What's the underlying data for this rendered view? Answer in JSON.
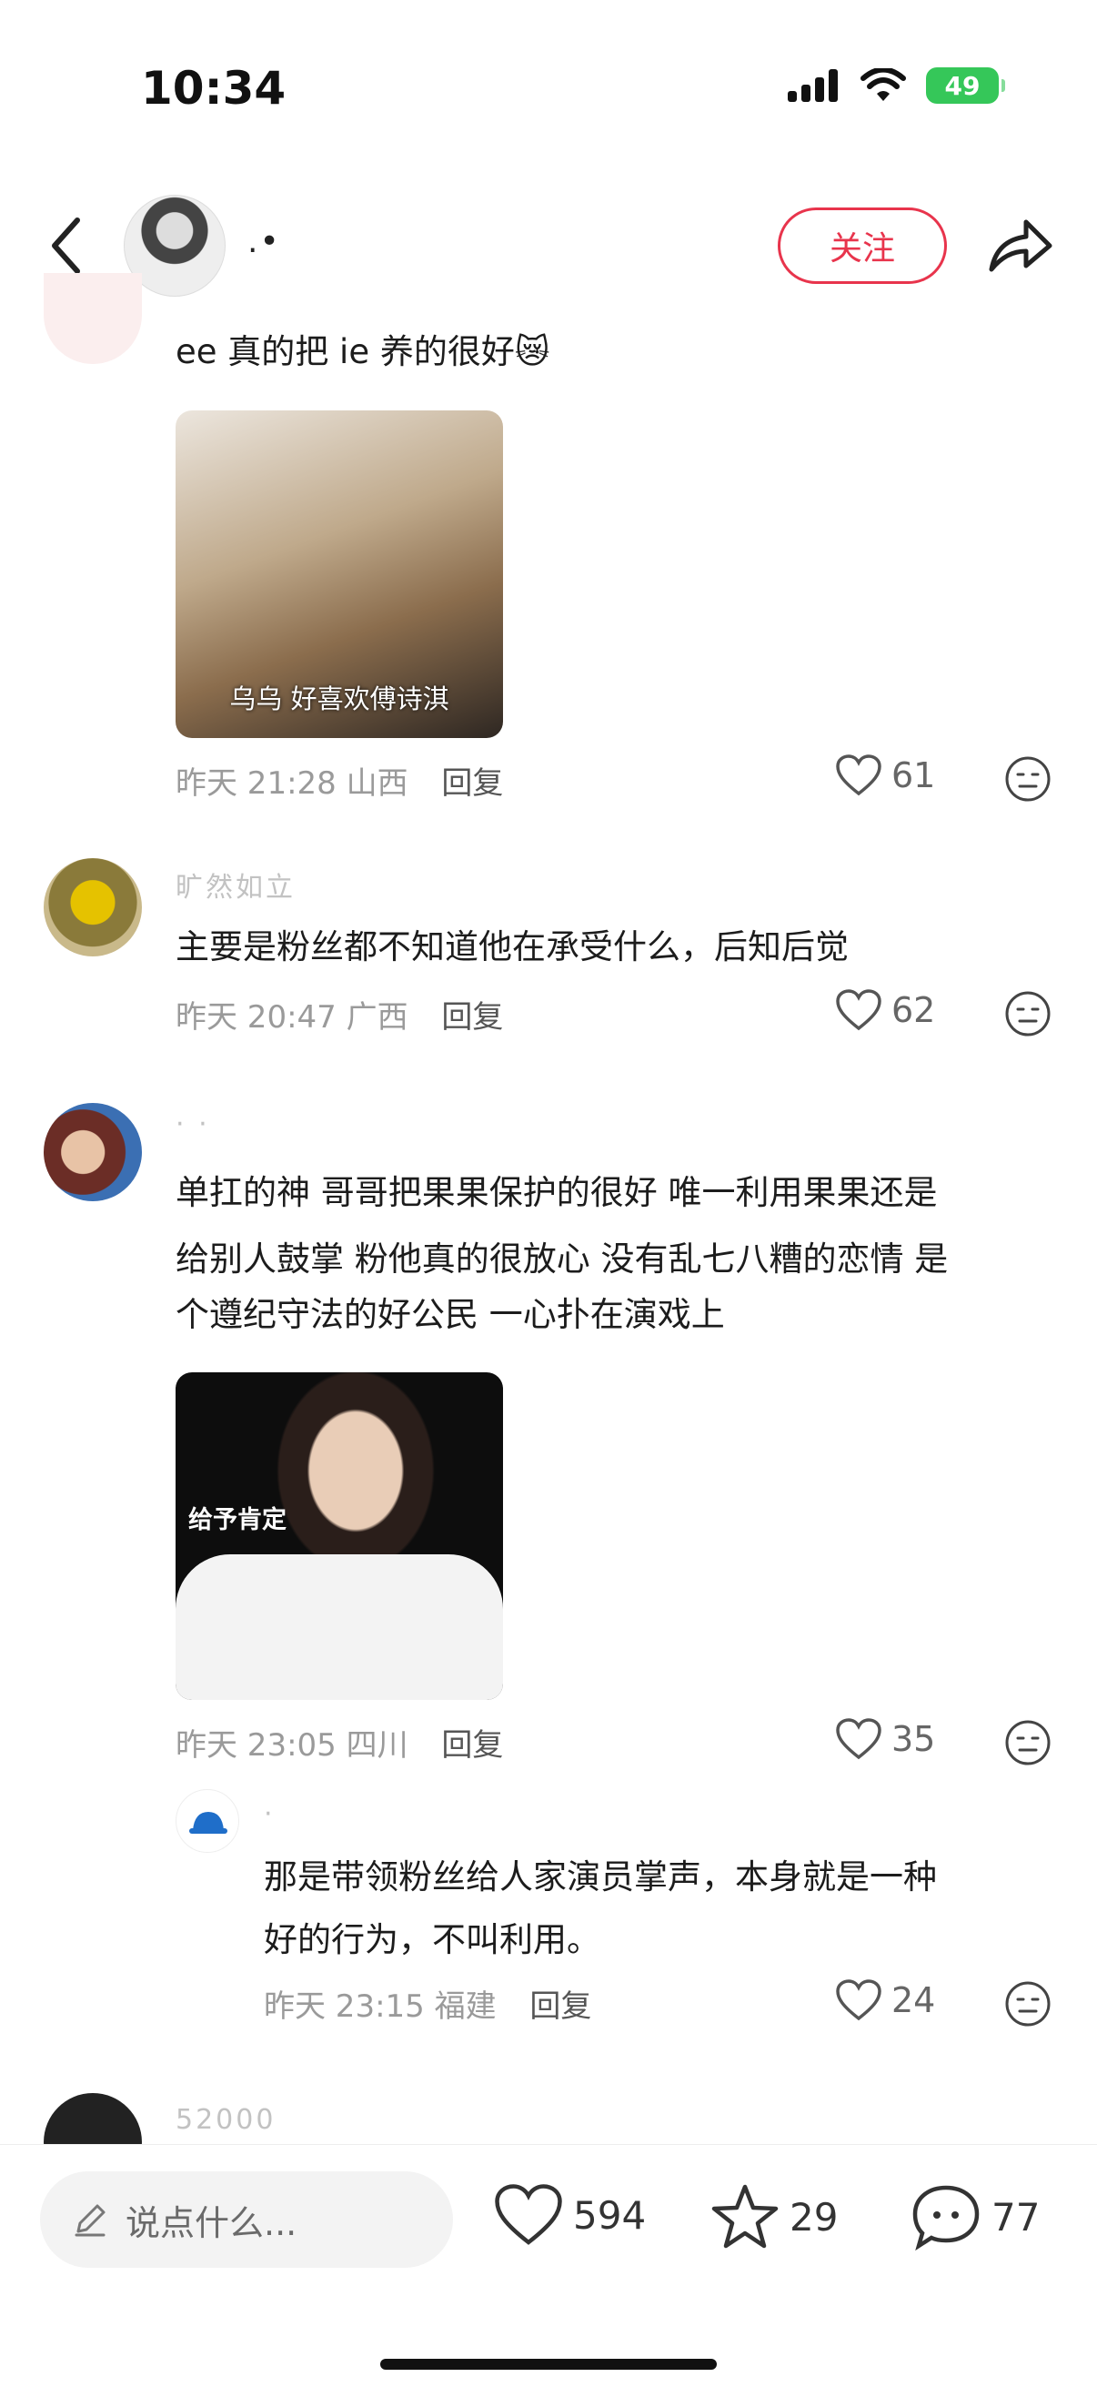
{
  "status": {
    "time": "10:34",
    "battery": "49"
  },
  "header": {
    "author_name": ".•",
    "follow_label": "关注"
  },
  "comments": [
    {
      "text": "ee 真的把 ie 养的很好😿",
      "sticker_caption": "乌乌 好喜欢傅诗淇",
      "time": "昨天 21:28",
      "location": "山西",
      "reply": "回复",
      "likes": "61"
    },
    {
      "username": "旷然如立",
      "text": "主要是粉丝都不知道他在承受什么，后知后觉",
      "time": "昨天 20:47",
      "location": "广西",
      "reply": "回复",
      "likes": "62"
    },
    {
      "username": "·   ·",
      "text_lines": [
        "单扛的神 哥哥把果果保护的很好 唯一利用果果还是",
        "给别人鼓掌 粉他真的很放心 没有乱七八糟的恋情 是",
        "个遵纪守法的好公民 一心扑在演戏上"
      ],
      "sticker_caption": "给予肯定",
      "time": "昨天 23:05",
      "location": "四川",
      "reply": "回复",
      "likes": "35"
    },
    {
      "username": "·",
      "text_lines": [
        "那是带领粉丝给人家演员掌声，本身就是一种",
        "好的行为，不叫利用。"
      ],
      "time": "昨天 23:15",
      "location": "福建",
      "reply": "回复",
      "likes": "24"
    },
    {
      "username": "52000"
    }
  ],
  "bottom": {
    "placeholder": "说点什么...",
    "likes": "594",
    "favorites": "29",
    "comments": "77"
  },
  "colors": {
    "accent": "#e8344c",
    "battery": "#35c759"
  }
}
